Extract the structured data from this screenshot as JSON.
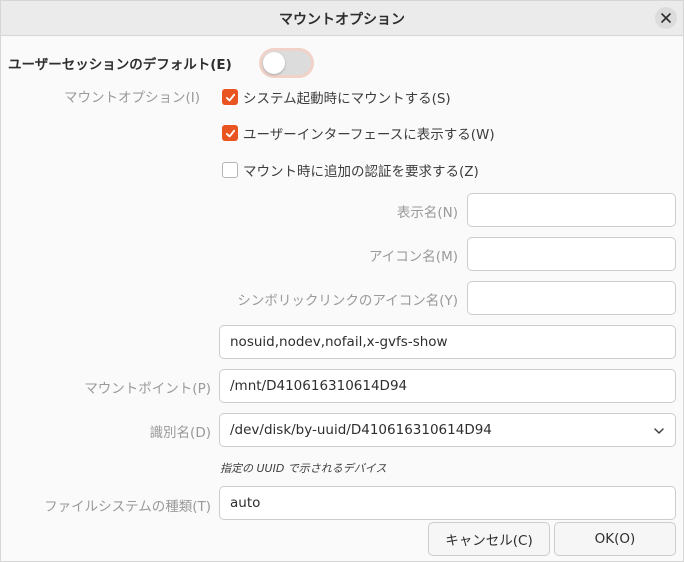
{
  "window": {
    "title": "マウントオプション",
    "close_icon": "close-icon"
  },
  "user_default": {
    "label": "ユーザーセッションのデフォルト(E)",
    "switch_on": false
  },
  "mount_options": {
    "label": "マウントオプション(I)",
    "checks": [
      {
        "label": "システム起動時にマウントする(S)",
        "checked": true
      },
      {
        "label": "ユーザーインターフェースに表示する(W)",
        "checked": true
      },
      {
        "label": "マウント時に追加の認証を要求する(Z)",
        "checked": false
      }
    ]
  },
  "fields": {
    "display_name": {
      "label": "表示名(N)",
      "value": ""
    },
    "icon_name": {
      "label": "アイコン名(M)",
      "value": ""
    },
    "symbolic_icon_name": {
      "label": "シンボリックリンクのアイコン名(Y)",
      "value": ""
    },
    "options": {
      "value": "nosuid,nodev,nofail,x-gvfs-show"
    },
    "mount_point": {
      "label": "マウントポイント(P)",
      "value": "/mnt/D410616310614D94"
    },
    "identifier": {
      "label": "識別名(D)",
      "value": "/dev/disk/by-uuid/D410616310614D94",
      "hint": "指定の UUID で示されるデバイス"
    },
    "fs_type": {
      "label": "ファイルシステムの種類(T)",
      "value": "auto"
    }
  },
  "buttons": {
    "cancel": "キャンセル(C)",
    "ok": "OK(O)"
  },
  "colors": {
    "accent": "#e95420",
    "switch_focus": "#f1d2c8"
  }
}
